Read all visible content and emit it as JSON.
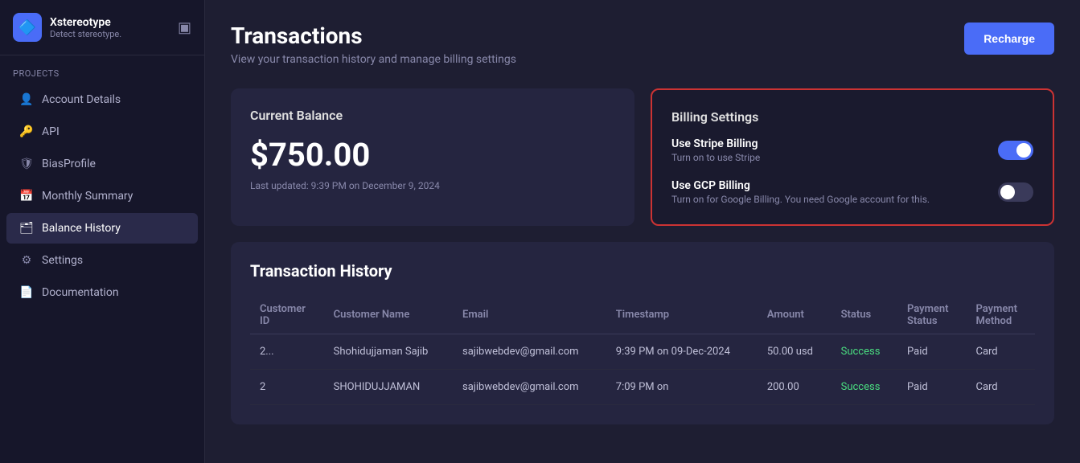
{
  "app": {
    "name": "Xstereotype",
    "tagline": "Detect stereotype.",
    "logo_icon": "🔷"
  },
  "sidebar": {
    "projects_label": "Projects",
    "toggle_icon": "▣",
    "items": [
      {
        "id": "account-details",
        "label": "Account Details",
        "icon": "👤",
        "active": false
      },
      {
        "id": "api",
        "label": "API",
        "icon": "🔑",
        "active": false
      },
      {
        "id": "bias-profile",
        "label": "BiasProfile",
        "icon": "🛡",
        "active": false
      },
      {
        "id": "monthly-summary",
        "label": "Monthly Summary",
        "icon": "📅",
        "active": false
      },
      {
        "id": "balance-history",
        "label": "Balance History",
        "icon": "🗂",
        "active": true
      },
      {
        "id": "settings",
        "label": "Settings",
        "icon": "⚙",
        "active": false
      },
      {
        "id": "documentation",
        "label": "Documentation",
        "icon": "📄",
        "active": false
      }
    ]
  },
  "page": {
    "title": "Transactions",
    "subtitle": "View your transaction history and manage billing settings",
    "recharge_label": "Recharge"
  },
  "balance_card": {
    "title": "Current Balance",
    "amount": "$750.00",
    "updated": "Last updated: 9:39 PM on December 9, 2024"
  },
  "billing_card": {
    "title": "Billing Settings",
    "stripe": {
      "title": "Use Stripe Billing",
      "desc": "Turn on to use Stripe",
      "enabled": true
    },
    "gcp": {
      "title": "Use GCP Billing",
      "desc": "Turn on for Google Billing. You need Google account for this.",
      "enabled": false
    }
  },
  "transaction_history": {
    "title": "Transaction History",
    "columns": [
      "Customer ID",
      "Customer Name",
      "Email",
      "Timestamp",
      "Amount",
      "Status",
      "Payment Status",
      "Payment Method"
    ],
    "rows": [
      {
        "customer_id": "2...",
        "customer_name": "Shohidujjaman Sajib",
        "email": "sajibwebdev@gmail.com",
        "timestamp": "9:39 PM on 09-Dec-2024",
        "amount": "50.00 usd",
        "status": "Success",
        "payment_status": "Paid",
        "payment_method": "Card"
      },
      {
        "customer_id": "2",
        "customer_name": "SHOHIDUJJAMAN",
        "email": "sajibwebdev@gmail.com",
        "timestamp": "7:09 PM on",
        "amount": "200.00",
        "status": "Success",
        "payment_status": "Paid",
        "payment_method": "Card"
      }
    ]
  }
}
